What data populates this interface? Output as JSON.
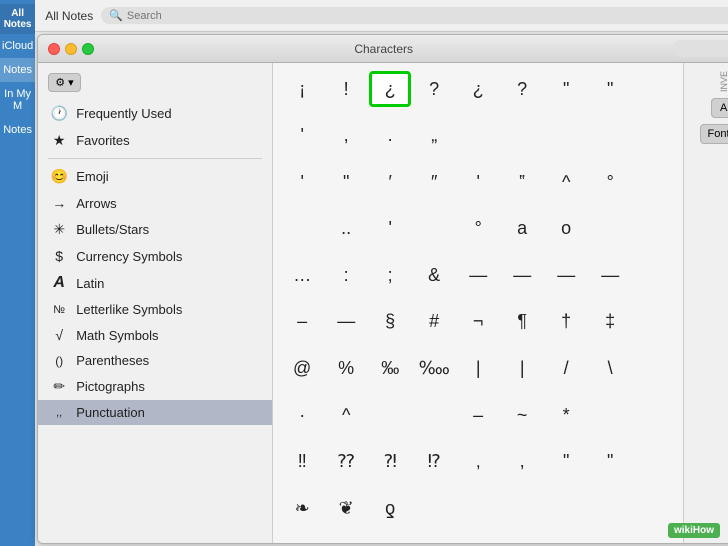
{
  "app": {
    "title": "All Notes",
    "search_placeholder": "Search",
    "compose_icon": "✎"
  },
  "sidebar": {
    "items": [
      {
        "label": "iCloud",
        "active": false
      },
      {
        "label": "Notes",
        "active": true
      },
      {
        "label": "In My M",
        "active": false
      },
      {
        "label": "Notes",
        "active": false
      }
    ]
  },
  "characters_window": {
    "title": "Characters",
    "search_placeholder": "🔍",
    "gear_label": "⚙ ▾",
    "menu_items": [
      {
        "icon": "🕐",
        "label": "Frequently Used"
      },
      {
        "icon": "★",
        "label": "Favorites"
      },
      {
        "divider": true
      },
      {
        "icon": "😊",
        "label": "Emoji"
      },
      {
        "icon": "→",
        "label": "Arrows"
      },
      {
        "icon": "✳",
        "label": "Bullets/Stars"
      },
      {
        "icon": "$",
        "label": "Currency Symbols"
      },
      {
        "icon": "A",
        "label": "Latin"
      },
      {
        "icon": "№",
        "label": "Letterlike Symbols"
      },
      {
        "icon": "√",
        "label": "Math Symbols"
      },
      {
        "icon": "()",
        "label": "Parentheses"
      },
      {
        "icon": "✏",
        "label": "Pictographs"
      },
      {
        "icon": ",,",
        "label": "Punctuation",
        "active": true
      }
    ],
    "characters": [
      "¡",
      "!",
      "¿",
      "?",
      "¿",
      "?",
      "“",
      "”",
      "‘",
      ",",
      ".",
      "„",
      "",
      "",
      "",
      "",
      "’",
      "”",
      "′",
      "″",
      "‘",
      "‟",
      "^",
      "°",
      "",
      "..",
      "‘",
      "",
      "°",
      "a",
      "o",
      "",
      "…",
      ":",
      ";",
      "&",
      "—",
      "—",
      "—",
      "—",
      "–",
      "—",
      "§",
      "#",
      "¬",
      "¶",
      "†",
      "‡",
      "@",
      "%",
      "‰",
      "‱",
      "|",
      "|",
      "/",
      "\\",
      ".",
      "^",
      "",
      "",
      "–",
      "~",
      "*",
      "",
      "‼",
      "⁇",
      "⁈",
      "⁉",
      "‚",
      ",",
      "“",
      "”",
      "❧",
      "❦",
      "ƍ",
      "",
      "",
      "",
      "",
      ""
    ],
    "selected_char": "¿",
    "selected_index": 2,
    "right_panel": {
      "inve_label": "INVE",
      "a_label": "A",
      "font_label": "Font V"
    }
  },
  "wikihow": {
    "label": "wikiHow"
  }
}
